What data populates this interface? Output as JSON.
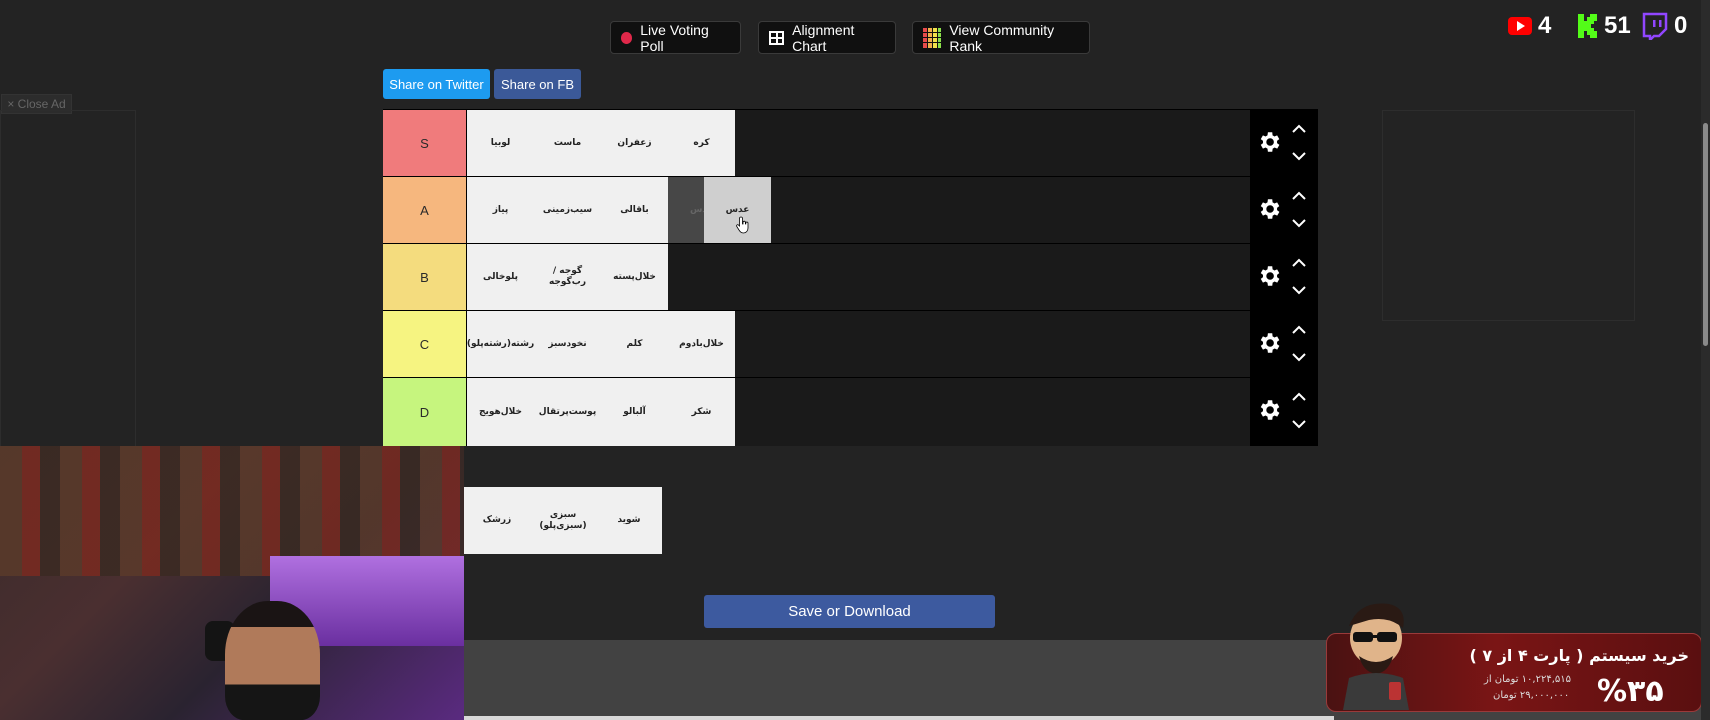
{
  "top_buttons": {
    "live_poll": "Live Voting Poll",
    "alignment": "Alignment Chart",
    "community": "View Community Rank"
  },
  "share": {
    "twitter": "Share on Twitter",
    "fb": "Share on FB"
  },
  "close_ad": "× Close Ad",
  "stats": {
    "youtube": "4",
    "kick": "51",
    "twitch": "0"
  },
  "tiers": [
    {
      "label": "S",
      "color": "#f07b7c",
      "items": [
        "لوبیا",
        "ماست",
        "زعفران",
        "کره"
      ]
    },
    {
      "label": "A",
      "color": "#f6b77e",
      "items": [
        "پیاز",
        "سیب‌زمینی",
        "باقالی"
      ],
      "ghost": "عدس",
      "drag": "عدس"
    },
    {
      "label": "B",
      "color": "#f4dc7e",
      "items": [
        "پلوخالی",
        "گوجه / رب‌گوجه",
        "خلال‌پسته"
      ]
    },
    {
      "label": "C",
      "color": "#f6f481",
      "items": [
        "رشته(رشته‌پلو)",
        "نخودسبز",
        "کلم",
        "خلال‌بادوم"
      ]
    },
    {
      "label": "D",
      "color": "#c6f57e",
      "items": [
        "خلال‌هویج",
        "پوست‌پرتقال",
        "آلبالو",
        "شکر"
      ]
    }
  ],
  "pool": [
    "زرشک",
    "سبزی (سبزی‌پلو)",
    "شوید"
  ],
  "save_label": "Save or Download",
  "promo": {
    "title": "خرید سیستم ( پارت ۴ از ۷ )",
    "price_line1": "۱۰,۲۲۴,۵۱۵ تومان از",
    "price_line2": "۲۹,۰۰۰,۰۰۰ تومان",
    "percent": "%۳۵"
  },
  "colors": {
    "twitter": "#1d9bf0",
    "fb": "#3b5998",
    "save": "#3d5a9f",
    "youtube": "#ff0000",
    "kick": "#53fc18",
    "twitch": "#9146ff"
  }
}
